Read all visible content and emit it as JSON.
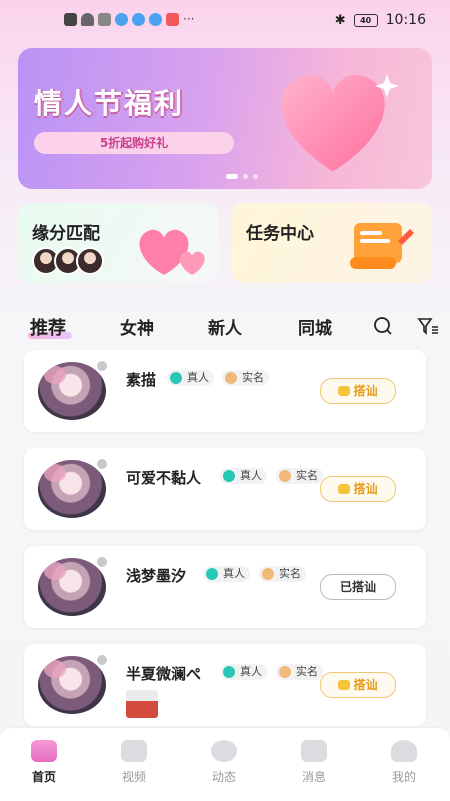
{
  "status_bar": {
    "time": "10:16",
    "battery": "40",
    "more": "···"
  },
  "banner": {
    "title": "情人节福利",
    "subtitle": "5折起购好礼"
  },
  "cards": {
    "match": {
      "title": "缘分匹配"
    },
    "task": {
      "title": "任务中心"
    }
  },
  "tabs": [
    "推荐",
    "女神",
    "新人",
    "同城"
  ],
  "users": [
    {
      "name": "素描",
      "badge_real": "真人",
      "badge_name": "实名",
      "action": "搭讪"
    },
    {
      "name": "可爱不黏人",
      "badge_real": "真人",
      "badge_name": "实名",
      "action": "搭讪"
    },
    {
      "name": "浅梦墨汐",
      "badge_real": "真人",
      "badge_name": "实名",
      "action": "已搭讪"
    },
    {
      "name": "半夏微澜ぺ",
      "badge_real": "真人",
      "badge_name": "实名",
      "action": "搭讪"
    }
  ],
  "nav": [
    "首页",
    "视频",
    "动态",
    "消息",
    "我的"
  ],
  "colors": {
    "accent_pink": "#e66bc1",
    "gold": "#e59b16",
    "teal": "#28c7b6"
  }
}
